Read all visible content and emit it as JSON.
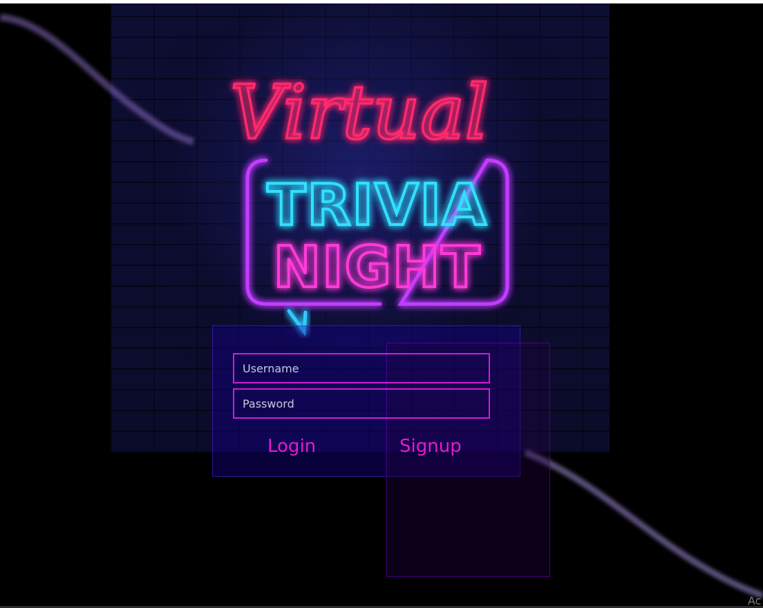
{
  "signage": {
    "script_word": "Virtual",
    "line1": "TRIVIA",
    "line2": "NIGHT"
  },
  "login_form": {
    "username_placeholder": "Username",
    "password_placeholder": "Password",
    "login_label": "Login",
    "signup_label": "Signup"
  },
  "corner_text": "Ac",
  "colors": {
    "background": "#000000",
    "neon_pink": "#ff2a6d",
    "neon_cyan": "#31e0ff",
    "neon_magenta": "#ff3bd8",
    "neon_purple": "#c13cff",
    "field_border": "#d61ad6",
    "button_text": "#e619cf"
  }
}
